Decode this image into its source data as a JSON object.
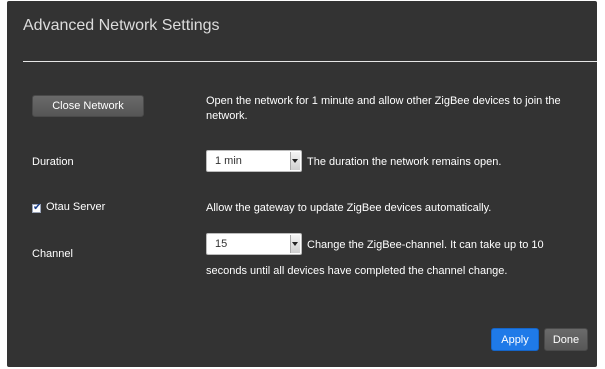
{
  "dialog": {
    "title": "Advanced Network Settings"
  },
  "close_network": {
    "button_label": "Close Network",
    "description": "Open the network for 1 minute and allow other ZigBee devices to join the network."
  },
  "duration": {
    "label": "Duration",
    "selected": "1 min",
    "description": "The duration the network remains open."
  },
  "otau": {
    "label": "Otau Server",
    "checked": true,
    "description": "Allow the gateway to update ZigBee devices automatically."
  },
  "channel": {
    "label": "Channel",
    "selected": "15",
    "description_line1": "Change the ZigBee-channel. It can take up to 10",
    "description_line2": "seconds until all devices have completed the channel change."
  },
  "footer": {
    "apply_label": "Apply",
    "done_label": "Done"
  },
  "colors": {
    "dialog_background": "#333333",
    "primary_button": "#1f7ae8",
    "secondary_button": "#606060"
  },
  "icons": {
    "select_arrow": "chevron-down-icon",
    "checkbox_tick": "checkmark-icon"
  }
}
